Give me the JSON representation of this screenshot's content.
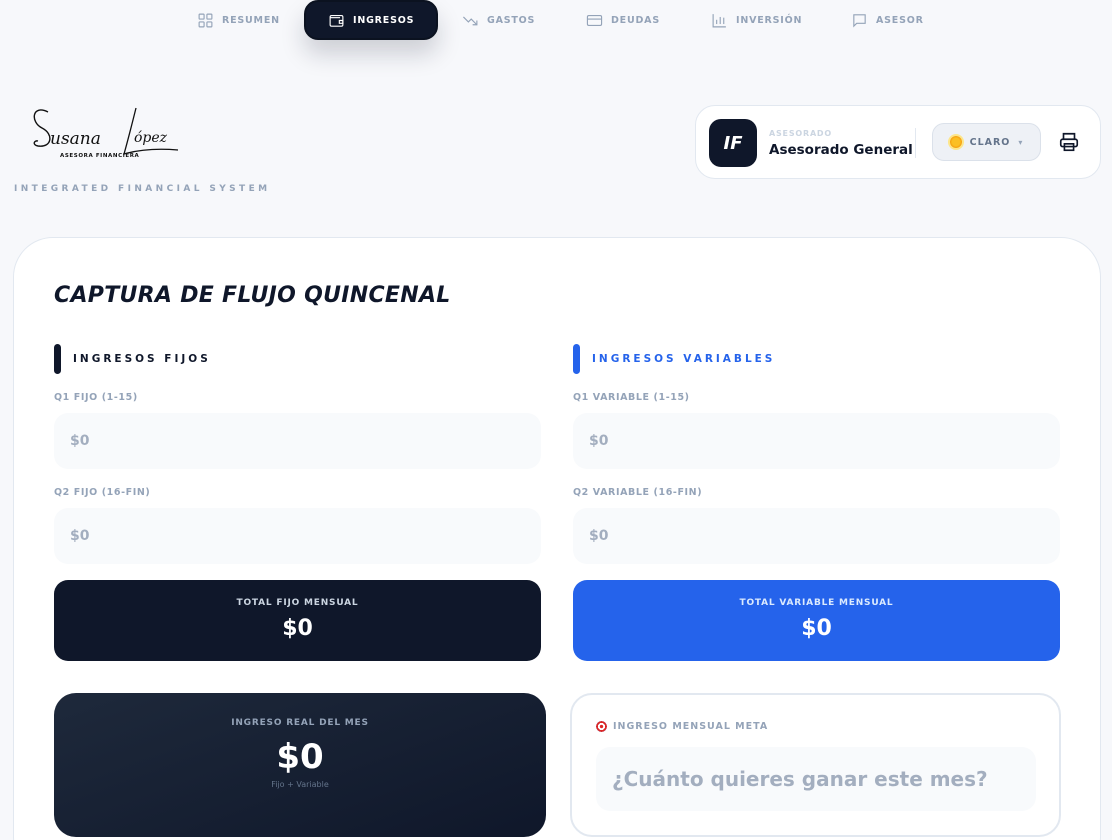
{
  "nav": {
    "items": [
      {
        "label": "RESUMEN",
        "icon": "grid-icon"
      },
      {
        "label": "INGRESOS",
        "icon": "wallet-icon",
        "active": true
      },
      {
        "label": "GASTOS",
        "icon": "trending-down-icon"
      },
      {
        "label": "DEUDAS",
        "icon": "credit-card-icon"
      },
      {
        "label": "INVERSIÓN",
        "icon": "bar-chart-icon"
      },
      {
        "label": "ASESOR",
        "icon": "message-icon"
      }
    ]
  },
  "brand": {
    "signature_name": "Susana López",
    "signature_subtitle": "ASESORA FINANCIERA",
    "tagline": "INTEGRATED FINANCIAL SYSTEM"
  },
  "advisee": {
    "initials": "IF",
    "label": "ASESORADO",
    "name": "Asesorado General"
  },
  "theme": {
    "label": "CLARO",
    "caret": "▾"
  },
  "page": {
    "title": "CAPTURA DE FLUJO QUINCENAL"
  },
  "fixed": {
    "section_label": "INGRESOS FIJOS",
    "q1_label": "Q1 FIJO (1-15)",
    "q1_placeholder": "$0",
    "q2_label": "Q2 FIJO (16-FIN)",
    "q2_placeholder": "$0",
    "total_label": "TOTAL FIJO MENSUAL",
    "total_value": "$0"
  },
  "variable": {
    "section_label": "INGRESOS VARIABLES",
    "q1_label": "Q1 VARIABLE (1-15)",
    "q1_placeholder": "$0",
    "q2_label": "Q2 VARIABLE (16-FIN)",
    "q2_placeholder": "$0",
    "total_label": "TOTAL VARIABLE MENSUAL",
    "total_value": "$0"
  },
  "real": {
    "label": "INGRESO REAL DEL MES",
    "value": "$0",
    "sub": "Fijo + Variable"
  },
  "goal": {
    "label": "INGRESO MENSUAL META",
    "placeholder": "¿Cuánto quieres ganar este mes?"
  },
  "colors": {
    "dark": "#0f172a",
    "accent_blue": "#2563eb",
    "muted": "#94a3b8"
  }
}
